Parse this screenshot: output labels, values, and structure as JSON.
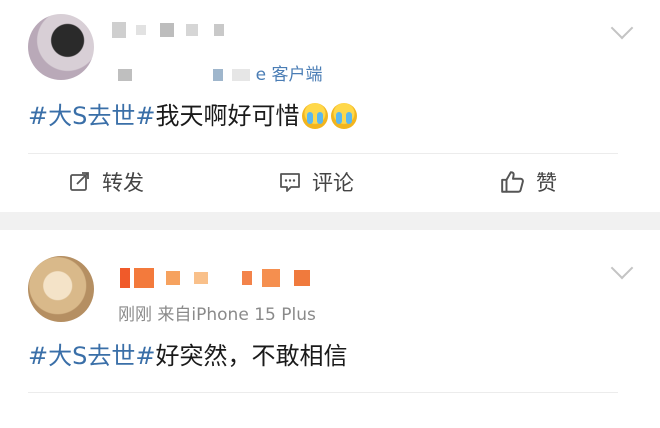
{
  "post1": {
    "source_suffix": "e 客户端",
    "content": {
      "hashtag": "#大S去世#",
      "text": "我天啊好可惜"
    },
    "emojis": [
      "crying-face-icon",
      "crying-face-icon"
    ],
    "actions": {
      "repost": "转发",
      "comment": "评论",
      "like": "赞"
    }
  },
  "post2": {
    "time_source": "刚刚 来自iPhone 15 Plus",
    "content": {
      "hashtag": "#大S去世#",
      "text": "好突然，不敢相信"
    }
  },
  "colors": {
    "hashtag": "#3a6fa8",
    "separator_band": "#f1f1f1",
    "text": "#1a1a1a",
    "meta": "#8a8a8a"
  }
}
